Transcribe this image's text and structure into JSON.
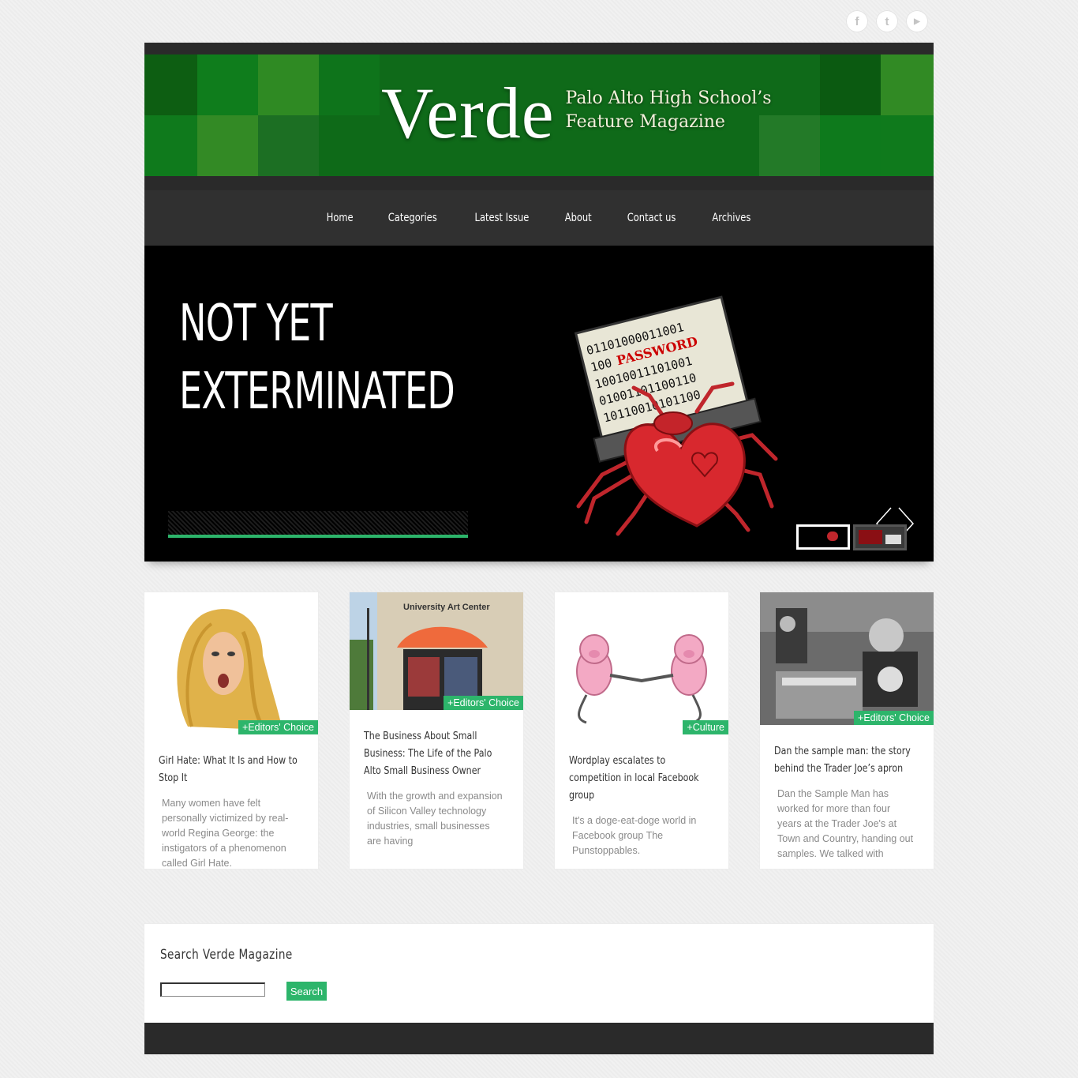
{
  "social": [
    {
      "icon": "facebook-icon",
      "glyph": "f"
    },
    {
      "icon": "twitter-icon",
      "glyph": "t"
    },
    {
      "icon": "youtube-icon",
      "glyph": "▶"
    }
  ],
  "header": {
    "title": "Verde",
    "subtitle_line1": "Palo Alto High School’s",
    "subtitle_line2": "Feature Magazine"
  },
  "nav": [
    "Home",
    "Categories",
    "Latest Issue",
    "About",
    "Contact us",
    "Archives"
  ],
  "slider": {
    "title_line1": "NOT YET",
    "title_line2": "EXTERMINATED",
    "progress": 1.0,
    "thumbs": 2,
    "active_thumb": 0
  },
  "cards": [
    {
      "tag": "+Editors' Choice",
      "title": "Girl Hate: What It Is and How to Stop It",
      "excerpt": "Many women have felt personally victimized by real-world Regina George: the instigators of a phenomenon called Girl Hate."
    },
    {
      "tag": "+Editors' Choice",
      "title": "The Business About Small Business: The Life of the Palo Alto Small Business Owner",
      "excerpt": "With the growth and expansion of Silicon Valley technology industries, small businesses are having"
    },
    {
      "tag": "+Culture",
      "title": "Wordplay escalates to competition in local Facebook group",
      "excerpt": "It's a doge-eat-doge world in Facebook group The Punstoppables."
    },
    {
      "tag": "+Editors' Choice",
      "title": "Dan the sample man: the story behind the Trader Joe’s apron",
      "excerpt": "Dan the Sample Man has worked for more than four years at the Trader Joe's at Town and Country, handing out samples. We talked with"
    }
  ],
  "card_images": {
    "storefront_sign": "University Art Center",
    "laptop_word": "PASSWORD"
  },
  "search": {
    "heading": "Search Verde Magazine",
    "button": "Search",
    "value": ""
  },
  "colors": {
    "accent": "#2db56b",
    "banner_green": "#0f6a19",
    "dark": "#2a2a2a",
    "nav": "#303030"
  }
}
